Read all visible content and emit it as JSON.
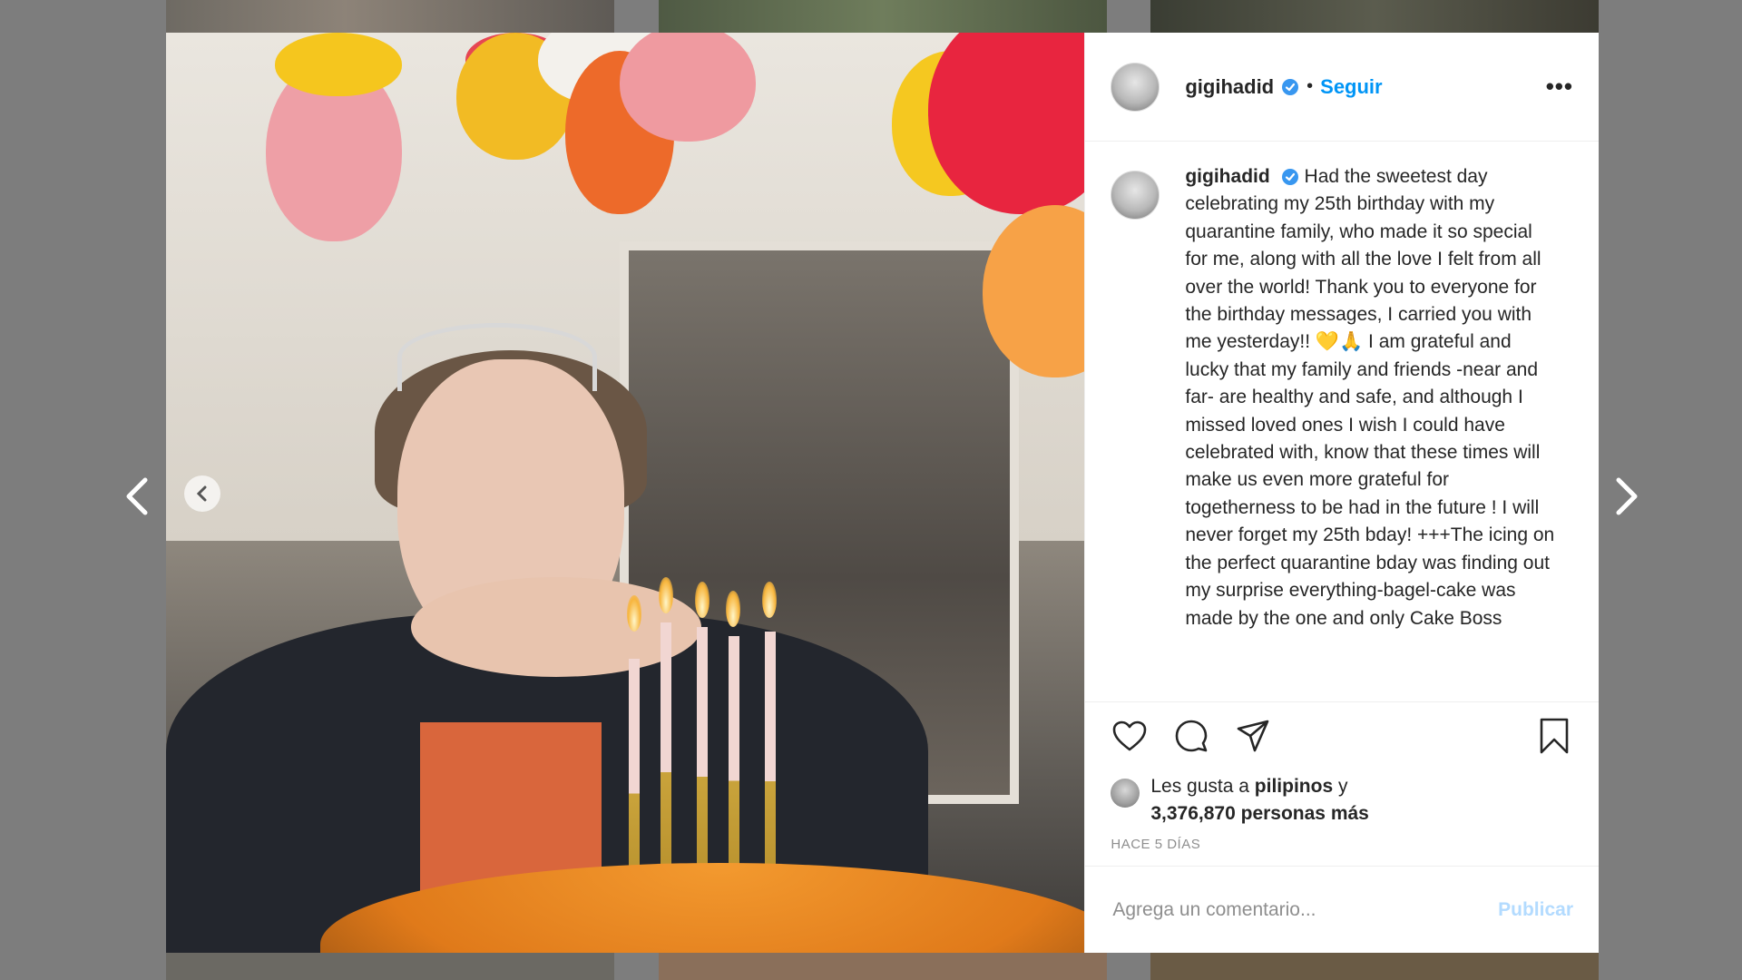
{
  "post": {
    "username": "gigihadid",
    "follow_label": "Seguir",
    "separator": "•",
    "more_label": "•••",
    "caption": "Had the sweetest day celebrating my 25th birthday with my quarantine family, who made it so special for me, along with all the love I felt from all over the world! Thank you to everyone for the birthday messages, I carried you with me yesterday!! 💛🙏 I am grateful and lucky that my family and friends -near and far- are healthy and safe, and although I missed loved ones I wish I could have celebrated with, know that these times will make us even more grateful for togetherness to be had in the future ! I will never forget my 25th bday! +++The icing on the perfect quarantine bday was finding out my surprise everything-bagel-cake was made by the one and only Cake Boss"
  },
  "likes": {
    "prefix": "Les gusta a",
    "user": "pilipinos",
    "conjunction": "y",
    "count_text": "3,376,870 personas más"
  },
  "timeago": "HACE 5 DÍAS",
  "comment": {
    "placeholder": "Agrega un comentario...",
    "publish_label": "Publicar"
  },
  "icons": {
    "verified": "verified-badge-icon",
    "like": "heart-icon",
    "comment": "comment-bubble-icon",
    "share": "paper-plane-icon",
    "save": "bookmark-icon",
    "prev": "chevron-left-icon",
    "next": "chevron-right-icon"
  },
  "colors": {
    "link_blue": "#0095f6",
    "publish_disabled": "#b3dbff",
    "text": "#262626",
    "muted": "#8e8e8e"
  }
}
